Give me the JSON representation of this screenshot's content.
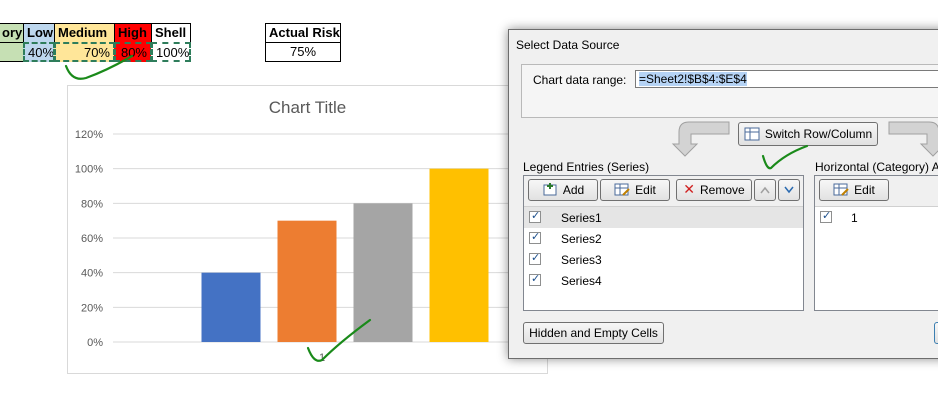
{
  "sheet": {
    "header_cells": {
      "category_fragment": "ory",
      "low": "Low",
      "medium": "Medium",
      "high": "High",
      "shell": "Shell",
      "actual_risk": "Actual Risk"
    },
    "value_cells": {
      "low": "40%",
      "medium": "70%",
      "high": "80%",
      "shell": "100%",
      "actual_risk": "75%"
    },
    "colors": {
      "category": "#c6e0b4",
      "low": "#bdd7ee",
      "medium": "#ffe699",
      "high": "#ff0000",
      "shell": "#ffffff"
    }
  },
  "chart_data": {
    "type": "bar",
    "title": "Chart Title",
    "categories": [
      "1"
    ],
    "series": [
      {
        "name": "Series1",
        "values": [
          40
        ],
        "color": "#4472c4"
      },
      {
        "name": "Series2",
        "values": [
          70
        ],
        "color": "#ed7d31"
      },
      {
        "name": "Series3",
        "values": [
          80
        ],
        "color": "#a5a5a5"
      },
      {
        "name": "Series4",
        "values": [
          100
        ],
        "color": "#ffc000"
      }
    ],
    "ylim": [
      0,
      120
    ],
    "y_ticks": [
      "0%",
      "20%",
      "40%",
      "60%",
      "80%",
      "100%",
      "120%"
    ],
    "grid": true,
    "xlabel": "",
    "ylabel": ""
  },
  "dialog": {
    "title": "Select Data Source",
    "range_label": "Chart data range:",
    "range_value": "=Sheet2!$B$4:$E$4",
    "switch_button": "Switch Row/Column",
    "legend_label": "Legend Entries (Series)",
    "axis_label": "Horizontal (Category) Ax",
    "add_button": "Add",
    "edit_button": "Edit",
    "remove_button": "Remove",
    "axis_edit_button": "Edit",
    "series": [
      {
        "label": "Series1",
        "checked": true
      },
      {
        "label": "Series2",
        "checked": true
      },
      {
        "label": "Series3",
        "checked": true
      },
      {
        "label": "Series4",
        "checked": true
      }
    ],
    "axis_items": [
      {
        "label": "1",
        "checked": true
      }
    ],
    "hidden_cells_button": "Hidden and Empty Cells"
  },
  "annotation_color": "#1a8a1a"
}
